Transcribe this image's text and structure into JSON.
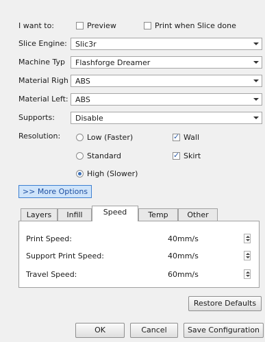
{
  "want_to": {
    "label": "I want to:",
    "preview": {
      "label": "Preview",
      "checked": false
    },
    "print_when_done": {
      "label": "Print when Slice done",
      "checked": false
    }
  },
  "fields": {
    "slice_engine": {
      "label": "Slice Engine:",
      "value": "Slic3r"
    },
    "machine_type": {
      "label": "Machine Typ",
      "value": "Flashforge Dreamer"
    },
    "material_right": {
      "label": "Material Righ",
      "value": "ABS"
    },
    "material_left": {
      "label": "Material Left:",
      "value": "ABS"
    },
    "supports": {
      "label": "Supports:",
      "value": "Disable"
    }
  },
  "resolution": {
    "label": "Resolution:",
    "options": [
      {
        "label": "Low (Faster)",
        "selected": false
      },
      {
        "label": "Standard",
        "selected": false
      },
      {
        "label": "High (Slower)",
        "selected": true
      }
    ],
    "wall": {
      "label": "Wall",
      "checked": true
    },
    "skirt": {
      "label": "Skirt",
      "checked": true
    }
  },
  "more_options_label": ">> More Options",
  "tabs": [
    {
      "label": "Layers",
      "active": false
    },
    {
      "label": "Infill",
      "active": false
    },
    {
      "label": "Speed",
      "active": true
    },
    {
      "label": "Temp",
      "active": false
    },
    {
      "label": "Other",
      "active": false
    }
  ],
  "speed": {
    "print_speed": {
      "label": "Print Speed:",
      "value": "40mm/s"
    },
    "support_print_speed": {
      "label": "Support Print Speed:",
      "value": "40mm/s"
    },
    "travel_speed": {
      "label": "Travel Speed:",
      "value": "60mm/s"
    }
  },
  "buttons": {
    "restore_defaults": "Restore Defaults",
    "ok": "OK",
    "cancel": "Cancel",
    "save_configuration": "Save Configuration"
  },
  "colors": {
    "more_options_border": "#3c7fd1",
    "more_options_bg": "#cfe4fa",
    "link_text": "#1e4fa0"
  }
}
